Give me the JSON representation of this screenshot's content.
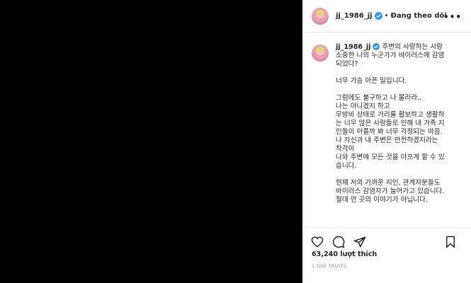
{
  "post": {
    "username": "jj_1986_jj",
    "follow_status": "Đang theo dõi",
    "more_menu": "•••",
    "caption": [
      {
        "text": "주변의 사랑하는 사람\n소중한 나의 누군가가 바이러스에 감염\n되었다?",
        "gap": false,
        "after_user": true
      },
      {
        "text": "너무 가슴 아픈 일입니다.",
        "gap": true
      },
      {
        "text": "그럼에도 불구하고 나 몰라라..\n나는 아니겠지 하고\n무방비 상태로 거리를 활보하고 생활하\n는 너무 많은 사람들로 인해 내 가족 지\n인들이 아플까 봐 너무 걱정되는 마음.\n나 자신과 내 주변은 안전하겠지라는\n착각이\n나와 주변에 모든 것을 아프게 할 수 있\n습니다.",
        "gap": true
      },
      {
        "text": "현재 저의 가까운 지인, 관계자분들도\n바이러스 감염자가 늘어가고 있습니다.\n절대 먼 곳의 이야기가 아닙니다.",
        "gap": true
      }
    ],
    "likes": "63,240 lượt thích",
    "time_ago": "1 GIỜ TRƯỚC",
    "icons": {
      "like": "heart-icon",
      "comment": "comment-icon",
      "share": "share-icon",
      "save": "bookmark-icon",
      "verified": "verified-badge-icon"
    },
    "colors": {
      "verified": "#3897f0",
      "text": "#262626",
      "muted": "#8e8e8e",
      "media_bg": "#000000"
    }
  }
}
